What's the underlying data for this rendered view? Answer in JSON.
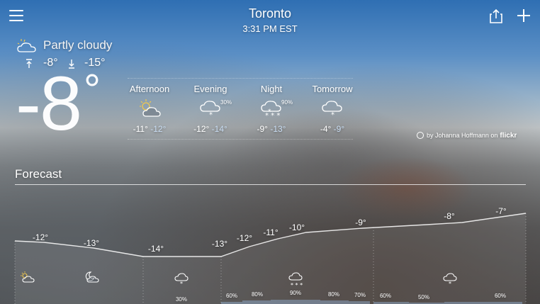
{
  "header": {
    "city": "Toronto",
    "time": "3:31 PM EST",
    "menu_icon": "hamburger-icon",
    "share_icon": "share-icon",
    "add_icon": "plus-icon"
  },
  "current": {
    "condition": "Partly cloudy",
    "condition_icon": "partly-cloudy-icon",
    "high": "-8°",
    "low": "-15°",
    "temp": "-8",
    "temp_deg": "°"
  },
  "periods": [
    {
      "label": "Afternoon",
      "high": "-11°",
      "low": "-12°",
      "icon": "partly-cloudy-sun-icon",
      "pct": ""
    },
    {
      "label": "Evening",
      "high": "-12°",
      "low": "-14°",
      "icon": "snow-cloud-icon",
      "pct": "30%"
    },
    {
      "label": "Night",
      "high": "-9°",
      "low": "-13°",
      "icon": "heavy-snow-cloud-icon",
      "pct": "90%"
    },
    {
      "label": "Tomorrow",
      "high": "-4°",
      "low": "-9°",
      "icon": "snow-cloud-icon",
      "pct": ""
    }
  ],
  "photo_credit": {
    "text": "by Johanna Hoffmann on",
    "brand": "flickr",
    "icon": "camera-icon"
  },
  "forecast": {
    "title": "Forecast",
    "temperatures": [
      "-12°",
      "-13°",
      "-14°",
      "-13°",
      "-12°",
      "-11°",
      "-10°",
      "-9°",
      "-8°",
      "-7°"
    ],
    "precip_percents": [
      "30%",
      "60%",
      "80%",
      "90%",
      "80%",
      "70%",
      "60%",
      "50%",
      "60%"
    ],
    "icons": [
      "partly-cloudy-sun-icon",
      "partly-cloudy-moon-icon",
      "snow-cloud-icon",
      "heavy-snow-cloud-icon",
      "snow-cloud-icon"
    ]
  },
  "colors": {
    "low_temp": "#c8dcf2",
    "sun": "#f2c94c"
  }
}
